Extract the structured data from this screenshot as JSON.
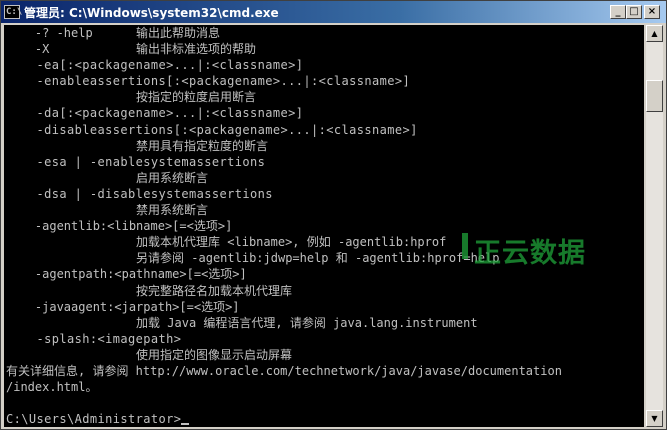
{
  "window": {
    "title": "管理员: C:\\Windows\\system32\\cmd.exe",
    "icon": "cmd-icon",
    "controls": {
      "minimize": "_",
      "maximize": "□",
      "close": "×"
    }
  },
  "console": {
    "lines": [
      "    -? -help      输出此帮助消息",
      "    -X            输出非标准选项的帮助",
      "    -ea[:<packagename>...|:<classname>]",
      "    -enableassertions[:<packagename>...|:<classname>]",
      "                  按指定的粒度启用断言",
      "    -da[:<packagename>...|:<classname>]",
      "    -disableassertions[:<packagename>...|:<classname>]",
      "                  禁用具有指定粒度的断言",
      "    -esa | -enablesystemassertions",
      "                  启用系统断言",
      "    -dsa | -disablesystemassertions",
      "                  禁用系统断言",
      "    -agentlib:<libname>[=<选项>]",
      "                  加载本机代理库 <libname>, 例如 -agentlib:hprof",
      "                  另请参阅 -agentlib:jdwp=help 和 -agentlib:hprof=help",
      "    -agentpath:<pathname>[=<选项>]",
      "                  按完整路径名加载本机代理库",
      "    -javaagent:<jarpath>[=<选项>]",
      "                  加载 Java 编程语言代理, 请参阅 java.lang.instrument",
      "    -splash:<imagepath>",
      "                  使用指定的图像显示启动屏幕",
      "有关详细信息, 请参阅 http://www.oracle.com/technetwork/java/javase/documentation",
      "/index.html。",
      ""
    ],
    "prompt": "C:\\Users\\Administrator>"
  },
  "watermark": "正云数据",
  "colors": {
    "console_bg": "#000000",
    "console_fg": "#c0c0c0",
    "titlebar": "#0a246a",
    "watermark": "#1fa33a"
  }
}
